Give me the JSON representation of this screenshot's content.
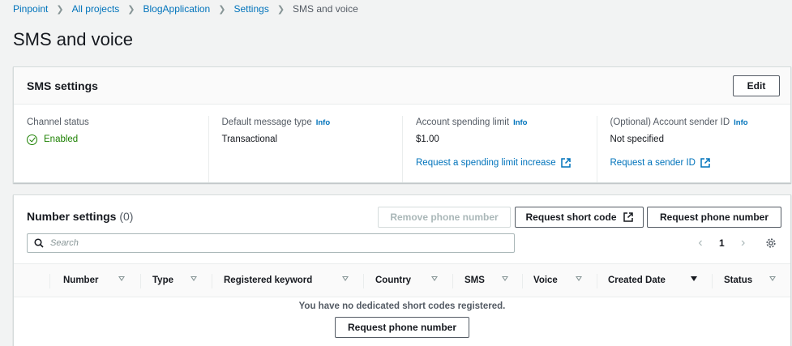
{
  "breadcrumb": [
    "Pinpoint",
    "All projects",
    "BlogApplication",
    "Settings",
    "SMS and voice"
  ],
  "page_title": "SMS and voice",
  "sms_settings": {
    "title": "SMS settings",
    "edit_label": "Edit",
    "columns": [
      {
        "label": "Channel status",
        "value": "Enabled"
      },
      {
        "label": "Default message type",
        "info": "Info",
        "value": "Transactional"
      },
      {
        "label": "Account spending limit",
        "info": "Info",
        "value": "$1.00",
        "link": "Request a spending limit increase"
      },
      {
        "label": "(Optional) Account sender ID",
        "info": "Info",
        "value": "Not specified",
        "link": "Request a sender ID"
      }
    ]
  },
  "number_settings": {
    "title": "Number settings",
    "count": "(0)",
    "remove_label": "Remove phone number",
    "request_short_code_label": "Request short code",
    "request_phone_label": "Request phone number",
    "search_placeholder": "Search",
    "page": "1",
    "columns": [
      "Number",
      "Type",
      "Registered keyword",
      "Country",
      "SMS",
      "Voice",
      "Created Date",
      "Status"
    ],
    "empty_message": "You have no dedicated short codes registered.",
    "empty_button_label": "Request phone number"
  },
  "colors": {
    "link": "#0073bb",
    "enabled": "#1d8102",
    "background": "#f2f3f3"
  },
  "icons": [
    "chevron-right-icon",
    "check-circle-icon",
    "external-link-icon",
    "search-icon",
    "chevron-left-icon",
    "gear-icon",
    "sort-icon"
  ]
}
